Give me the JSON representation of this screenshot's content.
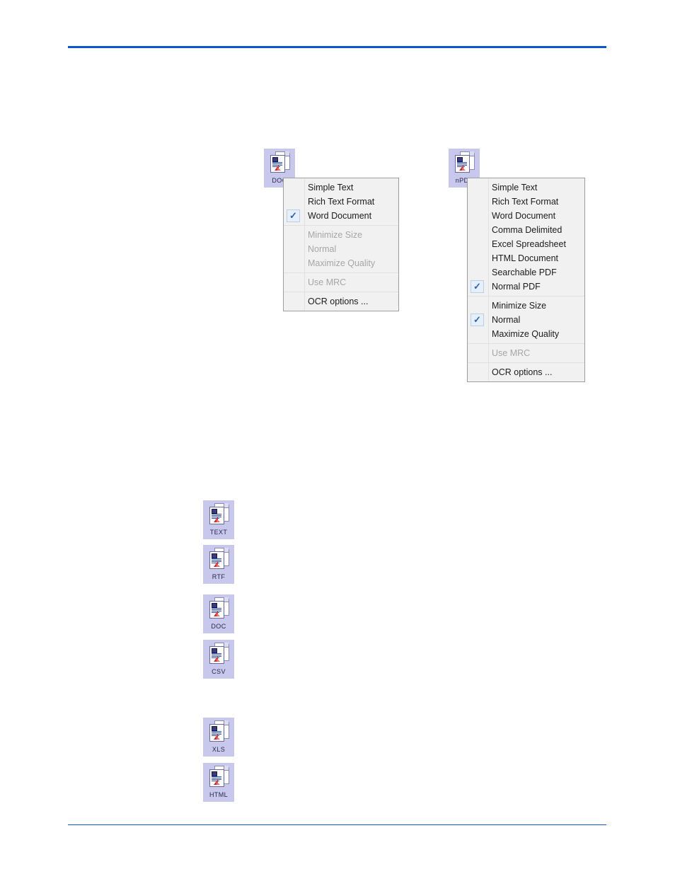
{
  "page": {
    "rule_color": "#0b57c9",
    "background": "#ffffff"
  },
  "icons": {
    "doc_anchor": {
      "label": "DOC",
      "name": "doc-file-icon"
    },
    "npdf_anchor": {
      "label": "nPDF",
      "name": "npdf-file-icon"
    },
    "list": [
      {
        "label": "TEXT"
      },
      {
        "label": "RTF"
      },
      {
        "label": "DOC"
      },
      {
        "label": "CSV"
      },
      {
        "label": "XLS"
      },
      {
        "label": "HTML"
      }
    ]
  },
  "menus": {
    "doc_menu": {
      "checkmark_glyph": "✓",
      "groups": [
        {
          "items": [
            {
              "label": "Simple Text",
              "checked": false,
              "disabled": false
            },
            {
              "label": "Rich Text Format",
              "checked": false,
              "disabled": false
            },
            {
              "label": "Word Document",
              "checked": true,
              "disabled": false
            }
          ]
        },
        {
          "items": [
            {
              "label": "Minimize Size",
              "checked": false,
              "disabled": true
            },
            {
              "label": "Normal",
              "checked": false,
              "disabled": true
            },
            {
              "label": "Maximize Quality",
              "checked": false,
              "disabled": true
            }
          ]
        },
        {
          "items": [
            {
              "label": "Use MRC",
              "checked": false,
              "disabled": true
            }
          ]
        },
        {
          "items": [
            {
              "label": "OCR options ...",
              "checked": false,
              "disabled": false
            }
          ]
        }
      ]
    },
    "npdf_menu": {
      "checkmark_glyph": "✓",
      "groups": [
        {
          "items": [
            {
              "label": "Simple Text",
              "checked": false,
              "disabled": false
            },
            {
              "label": "Rich Text Format",
              "checked": false,
              "disabled": false
            },
            {
              "label": "Word Document",
              "checked": false,
              "disabled": false
            },
            {
              "label": "Comma Delimited",
              "checked": false,
              "disabled": false
            },
            {
              "label": "Excel Spreadsheet",
              "checked": false,
              "disabled": false
            },
            {
              "label": "HTML Document",
              "checked": false,
              "disabled": false
            },
            {
              "label": "Searchable PDF",
              "checked": false,
              "disabled": false
            },
            {
              "label": "Normal PDF",
              "checked": true,
              "disabled": false
            }
          ]
        },
        {
          "items": [
            {
              "label": "Minimize Size",
              "checked": false,
              "disabled": false
            },
            {
              "label": "Normal",
              "checked": true,
              "disabled": false
            },
            {
              "label": "Maximize Quality",
              "checked": false,
              "disabled": false
            }
          ]
        },
        {
          "items": [
            {
              "label": "Use MRC",
              "checked": false,
              "disabled": true
            }
          ]
        },
        {
          "items": [
            {
              "label": "OCR options ...",
              "checked": false,
              "disabled": false
            }
          ]
        }
      ]
    }
  }
}
